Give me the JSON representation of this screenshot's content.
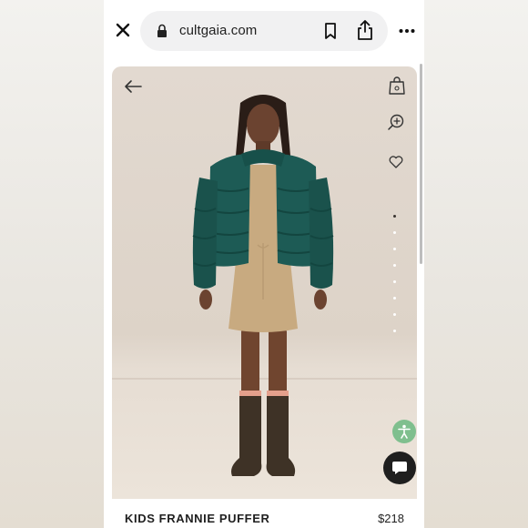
{
  "browser": {
    "url": "cultgaia.com",
    "icons": {
      "close": "close-icon",
      "lock": "lock-icon",
      "bookmark": "bookmark-icon",
      "share": "share-icon",
      "more": "more-horizontal-icon"
    }
  },
  "gallery": {
    "icons": {
      "back": "arrow-left-icon",
      "bag": "shopping-bag-icon",
      "zoom": "zoom-in-icon",
      "wishlist": "heart-icon",
      "accessibility": "accessibility-icon",
      "chat": "chat-icon"
    },
    "image_count": 8,
    "active_image_index": 0
  },
  "product": {
    "name": "KIDS FRANNIE PUFFER",
    "price": "$218"
  },
  "colors": {
    "accent_accessibility": "#7fbf8e",
    "chat_button": "#1f1f1f",
    "jacket": "#1d5b55"
  }
}
